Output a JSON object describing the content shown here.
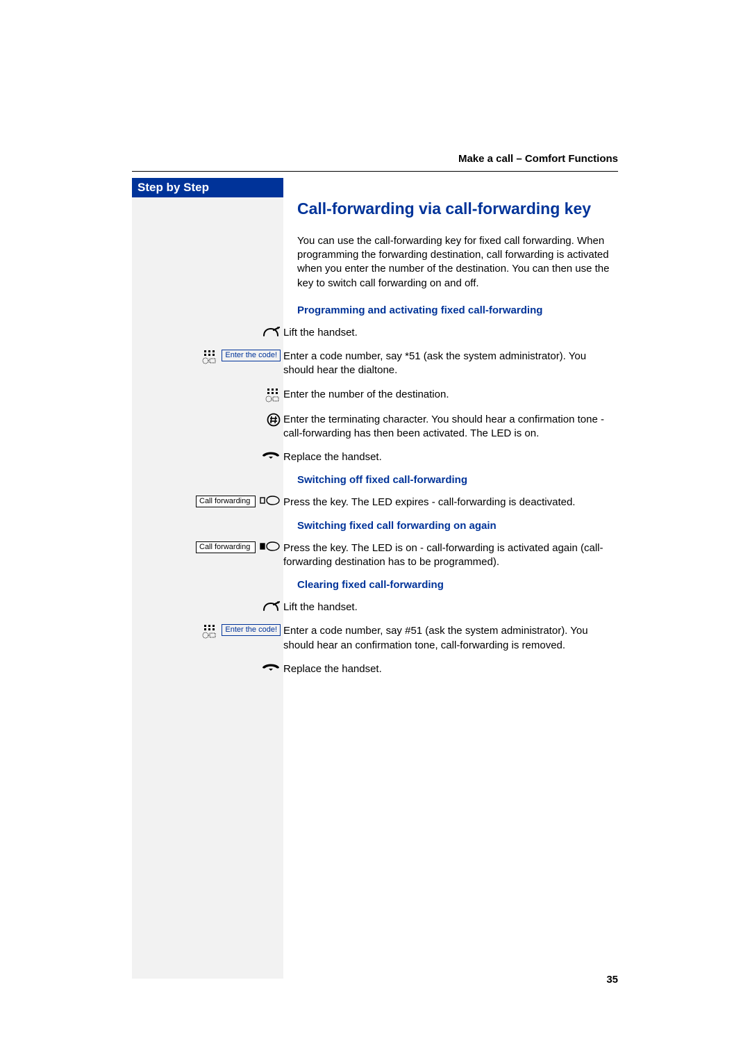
{
  "running_head": "Make a call – Comfort Functions",
  "sidebar_title": "Step by Step",
  "page_number": "35",
  "section": {
    "title": "Call-forwarding via call-forwarding key",
    "intro": "You can use the call-forwarding key for fixed call forwarding. When programming the forwarding destination, call forwarding is activated when you enter the number of the destination. You can then use the key to switch call forwarding on and off.",
    "sub1": {
      "heading": "Programming and activating fixed call-forwarding",
      "steps": {
        "lift": "Lift the handset.",
        "code_display": "Enter the code!",
        "enter_code": "Enter a code number, say *51 (ask the system administrator). You should hear the dialtone.",
        "enter_dest": "Enter the number of the destination.",
        "terminator": "Enter the terminating character. You should hear a confirmation tone - call-forwarding has then been activated. The LED is on.",
        "replace": "Replace the handset."
      }
    },
    "sub2": {
      "heading": "Switching off fixed call-forwarding",
      "key_label": "Call forwarding",
      "press_key": "Press the key. The LED expires - call-forwarding is deactivated."
    },
    "sub3": {
      "heading": "Switching fixed call forwarding on again",
      "key_label": "Call forwarding",
      "press_key": "Press the key. The LED is on - call-forwarding is activated again (call-forwarding destination has to be programmed)."
    },
    "sub4": {
      "heading": "Clearing fixed call-forwarding",
      "steps": {
        "lift": "Lift the handset.",
        "code_display": "Enter the code!",
        "enter_code": "Enter a code number, say #51 (ask the system administrator). You should hear an confirmation tone, call-forwarding is removed.",
        "replace": "Replace the handset."
      }
    }
  },
  "icons": {
    "lift_handset": "lift-handset-icon",
    "keypad": "keypad-icon",
    "hash_key": "hash-key-icon",
    "replace_handset": "replace-handset-icon",
    "led_off": "led-off-icon",
    "led_on": "led-on-icon"
  }
}
